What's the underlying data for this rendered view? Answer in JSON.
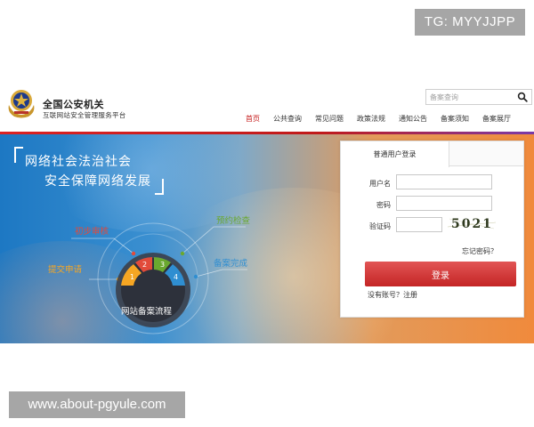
{
  "overlay": {
    "top_tag": "TG: MYYJJPP",
    "bottom_tag": "www.about-pgyule.com"
  },
  "header": {
    "emblem_icon": "police-emblem-icon",
    "title": "全国公安机关",
    "subtitle": "互联网站安全管理服务平台",
    "search": {
      "placeholder": "备案查询",
      "icon": "search-icon"
    },
    "nav": [
      {
        "label": "首页",
        "active": true
      },
      {
        "label": "公共查询"
      },
      {
        "label": "常见问题"
      },
      {
        "label": "政策法规"
      },
      {
        "label": "通知公告"
      },
      {
        "label": "备案须知"
      },
      {
        "label": "备案展厅"
      }
    ]
  },
  "banner": {
    "slogan_line1": "网络社会法治社会",
    "slogan_line2": "安全保障网络发展",
    "flow": {
      "center_label": "网站备案流程",
      "steps": [
        {
          "num": "1",
          "label": "提交申请",
          "color": "#f6a623"
        },
        {
          "num": "2",
          "label": "初步审核",
          "color": "#e24b3b"
        },
        {
          "num": "3",
          "label": "预约检查",
          "color": "#6aa82f"
        },
        {
          "num": "4",
          "label": "备案完成",
          "color": "#2f8ed1"
        }
      ]
    }
  },
  "login": {
    "tab_label": "普通用户登录",
    "username_label": "用户名",
    "password_label": "密码",
    "captcha_label": "验证码",
    "captcha_text": "5021",
    "forgot_label": "忘记密码？",
    "login_button": "登录",
    "register_text": "没有账号？注册"
  }
}
